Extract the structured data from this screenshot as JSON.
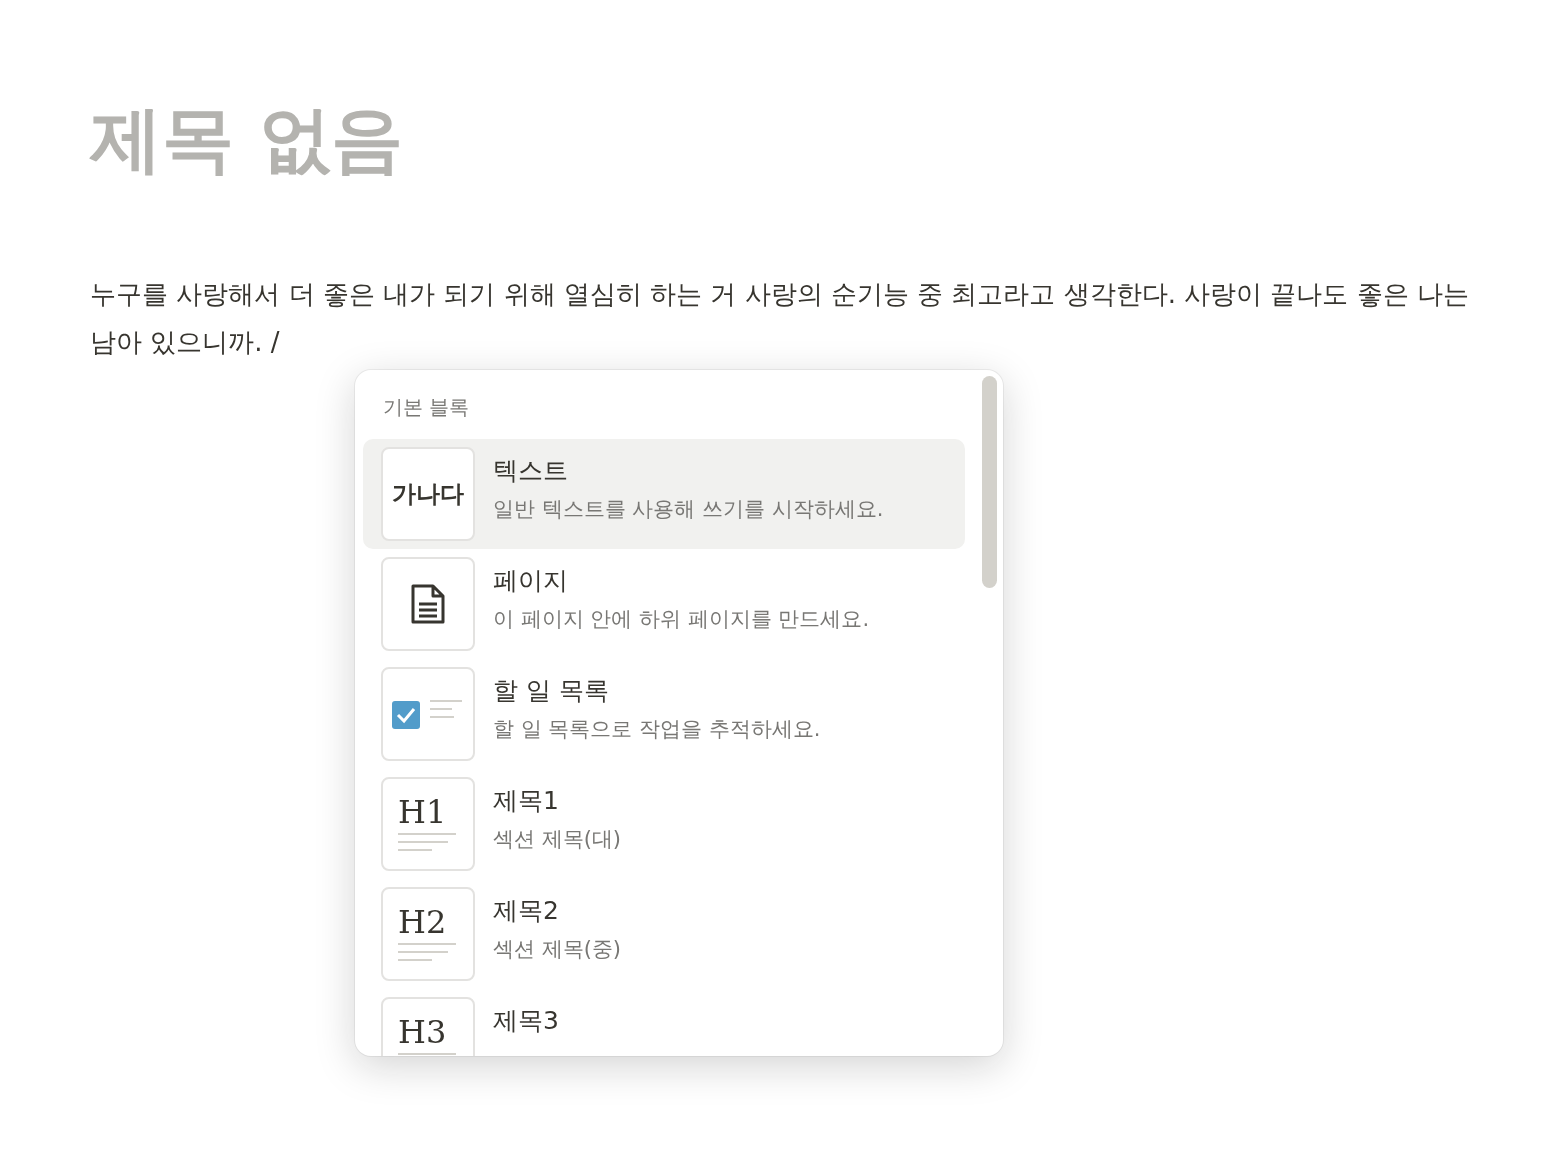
{
  "page": {
    "title": "제목 없음",
    "paragraph": "누구를 사랑해서 더 좋은 내가 되기 위해 열심히 하는 거 사랑의 순기능 중 최고라고 생각한다. 사랑이 끝나도 좋은 나는 남아 있으니까. /"
  },
  "menu": {
    "section": "기본 블록",
    "items": [
      {
        "kind": "text",
        "thumb": "가나다",
        "title": "텍스트",
        "description": "일반 텍스트를 사용해 쓰기를 시작하세요.",
        "selected": true
      },
      {
        "kind": "page",
        "title": "페이지",
        "description": "이 페이지 안에 하위 페이지를 만드세요.",
        "selected": false
      },
      {
        "kind": "todo",
        "title": "할 일 목록",
        "description": "할 일 목록으로 작업을 추적하세요.",
        "selected": false
      },
      {
        "kind": "heading",
        "thumb": "H1",
        "title": "제목1",
        "description": "섹션 제목(대)",
        "selected": false
      },
      {
        "kind": "heading",
        "thumb": "H2",
        "title": "제목2",
        "description": "섹션 제목(중)",
        "selected": false
      },
      {
        "kind": "heading",
        "thumb": "H3",
        "title": "제목3",
        "selected": false
      }
    ]
  }
}
